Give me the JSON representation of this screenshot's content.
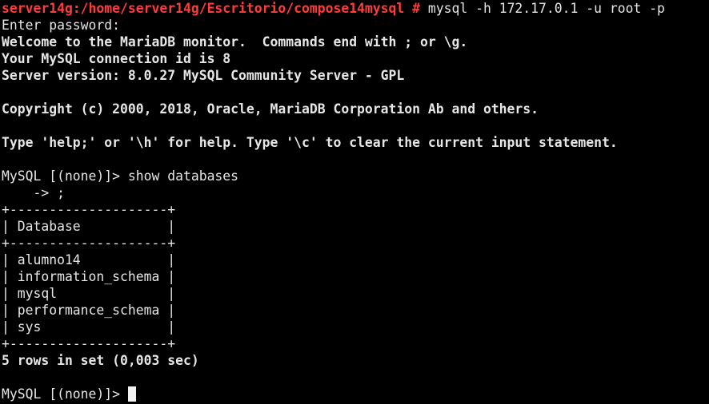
{
  "colors": {
    "background": "#000000",
    "foreground": "#e6e6e6",
    "prompt_path": "#ff3b3b",
    "cursor": "#f2f2f2"
  },
  "shell": {
    "prompt": "server14g:/home/server14g/Escritorio/compose14mysql #",
    "command": " mysql -h 172.17.0.1 -u root -p"
  },
  "login": {
    "password_prompt": "Enter password:",
    "welcome": "Welcome to the MariaDB monitor.  Commands end with ; or \\g.",
    "connection_id": "Your MySQL connection id is 8",
    "server_version": "Server version: 8.0.27 MySQL Community Server - GPL",
    "copyright": "Copyright (c) 2000, 2018, Oracle, MariaDB Corporation Ab and others.",
    "help": "Type 'help;' or '\\h' for help. Type '\\c' to clear the current input statement."
  },
  "query": {
    "prompt_line": "MySQL [(none)]> show databases",
    "continuation_line": "    -> ;"
  },
  "result": {
    "border": "+--------------------+",
    "header": "| Database           |",
    "rows": [
      "| alumno14           |",
      "| information_schema |",
      "| mysql              |",
      "| performance_schema |",
      "| sys                |"
    ],
    "summary": "5 rows in set (0,003 sec)"
  },
  "final_prompt": "MySQL [(none)]> "
}
